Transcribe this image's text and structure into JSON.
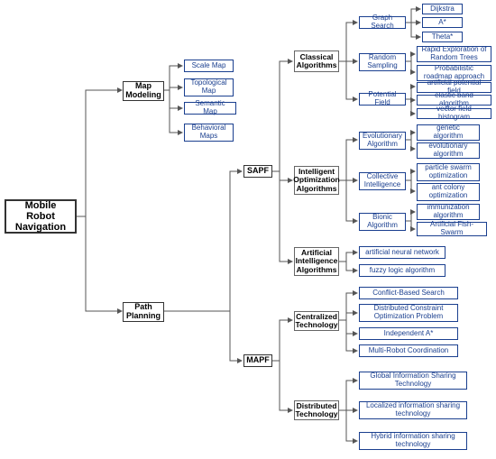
{
  "root": "Mobile Robot Navigation",
  "branches": {
    "map_modeling": "Map Modeling",
    "path_planning": "Path Planning"
  },
  "map_modeling_children": {
    "scale": "Scale Map",
    "topo": "Topological Map",
    "semantic": "Semantic Map",
    "behavioral": "Behavioral Maps"
  },
  "sapf": "SAPF",
  "mapf": "MAPF",
  "sapf_cats": {
    "classical": "Classical Algorithms",
    "intelligent": "Intelligent Optimization Algorithms",
    "ai": "Artificial Intelligence Algorithms"
  },
  "classical_sub": {
    "graph": "Graph Search",
    "random": "Random Sampling",
    "potential": "Potential Field"
  },
  "graph_leaves": {
    "dijkstra": "Dijkstra",
    "astar": "A*",
    "theta": "Theta*"
  },
  "random_leaves": {
    "rrt": "Rapid Exploration of Random Trees",
    "prm": "Probabilistic roadmap approach"
  },
  "potential_leaves": {
    "apf": "artificial potential field",
    "elastic": "elastic band algorithm",
    "vfh": "vector field histogram"
  },
  "intelligent_sub": {
    "evo": "Evolutionary Algorithm",
    "collective": "Collective Intelligence",
    "bionic": "Bionic Algorithm"
  },
  "evo_leaves": {
    "genetic": "genetic algorithm",
    "evoalg": "evolutionary algorithm"
  },
  "collective_leaves": {
    "pso": "particle swarm optimization",
    "aco": "ant colony optimization"
  },
  "bionic_leaves": {
    "immun": "immunization algorithm",
    "afs": "Artificial Fish-Swarm"
  },
  "ai_leaves": {
    "ann": "artificial neural network",
    "fuzzy": "fuzzy logic algorithm"
  },
  "mapf_cats": {
    "central": "Centralized Technology",
    "distrib": "Distributed Technology"
  },
  "central_leaves": {
    "cbs": "Conflict-Based Search",
    "dcop": "Distributed Constraint Optimization Problem",
    "ida": "Independent A*",
    "mrc": "Multi-Robot Coordination"
  },
  "distrib_leaves": {
    "global": "Global Information Sharing Technology",
    "local": "Localized information sharing technology",
    "hybrid": "Hybrid information sharing technology"
  }
}
